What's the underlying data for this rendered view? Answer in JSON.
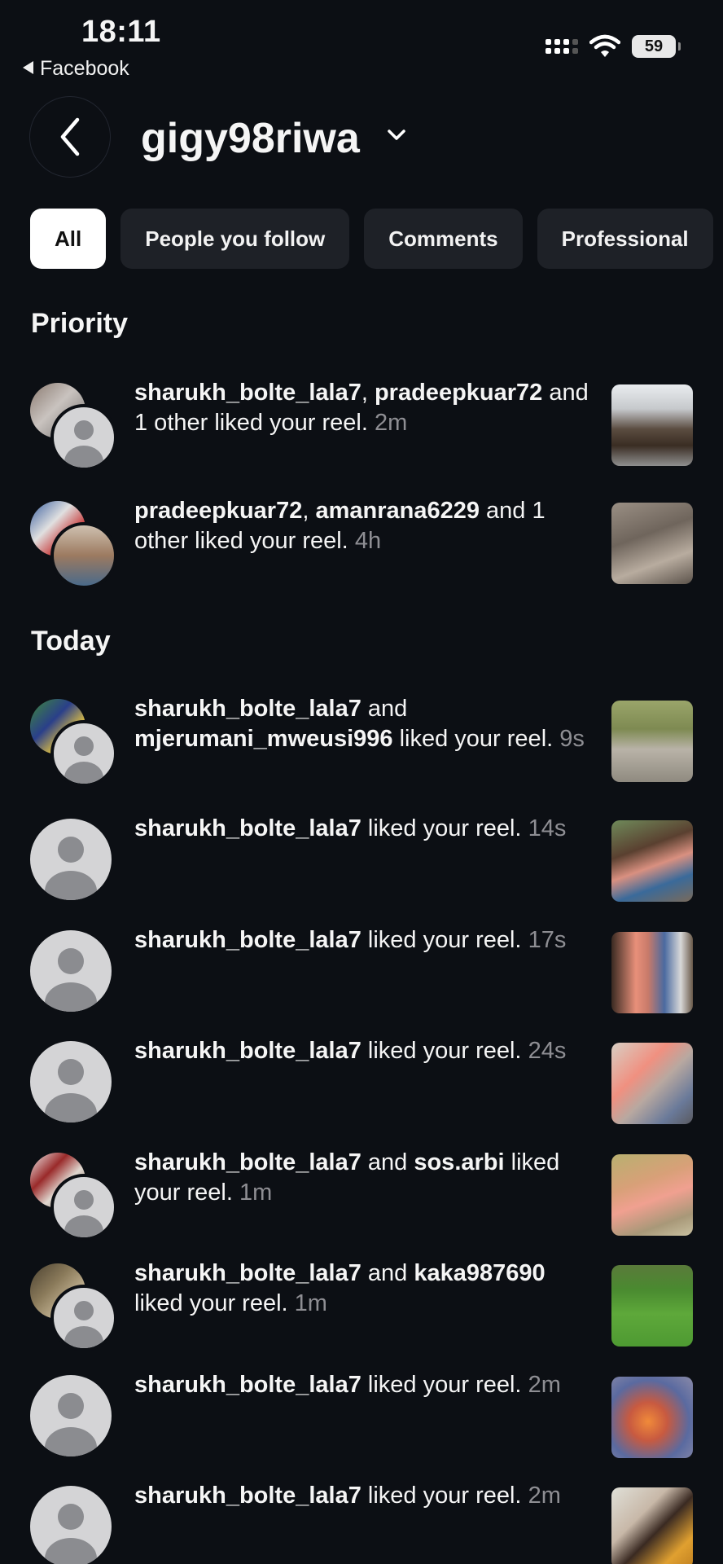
{
  "status": {
    "time": "18:11",
    "back_app": "Facebook",
    "battery": "59"
  },
  "header": {
    "title": "gigy98riwa"
  },
  "filters": [
    "All",
    "People you follow",
    "Comments",
    "Professional"
  ],
  "sections": {
    "priority": "Priority",
    "today": "Today"
  },
  "notifications": [
    {
      "users": [
        "sharukh_bolte_lala7",
        "pradeepkuar72"
      ],
      "sep": ", ",
      "suffix": " and 1 other liked your reel.",
      "time": "2m"
    },
    {
      "users": [
        "pradeepkuar72",
        "amanrana6229"
      ],
      "sep": ", ",
      "suffix": " and 1 other liked your reel.",
      "time": "4h"
    },
    {
      "users": [
        "sharukh_bolte_lala7",
        "mjerumani_mweusi996"
      ],
      "sep": " and ",
      "suffix": " liked your reel.",
      "time": "9s"
    },
    {
      "users": [
        "sharukh_bolte_lala7"
      ],
      "sep": "",
      "suffix": " liked your reel.",
      "time": "14s"
    },
    {
      "users": [
        "sharukh_bolte_lala7"
      ],
      "sep": "",
      "suffix": " liked your reel.",
      "time": "17s"
    },
    {
      "users": [
        "sharukh_bolte_lala7"
      ],
      "sep": "",
      "suffix": " liked your reel.",
      "time": "24s"
    },
    {
      "users": [
        "sharukh_bolte_lala7",
        "sos.arbi"
      ],
      "sep": " and ",
      "suffix": " liked your reel.",
      "time": "1m"
    },
    {
      "users": [
        "sharukh_bolte_lala7",
        "kaka987690"
      ],
      "sep": " and ",
      "suffix": " liked your reel.",
      "time": "1m"
    },
    {
      "users": [
        "sharukh_bolte_lala7"
      ],
      "sep": "",
      "suffix": " liked your reel.",
      "time": "2m"
    },
    {
      "users": [
        "sharukh_bolte_lala7"
      ],
      "sep": "",
      "suffix": " liked your reel.",
      "time": "2m"
    }
  ],
  "colors": {
    "background": "#0c0f14",
    "chip": "#1e2127",
    "chip_active": "#ffffff",
    "muted": "#8e8e93"
  }
}
